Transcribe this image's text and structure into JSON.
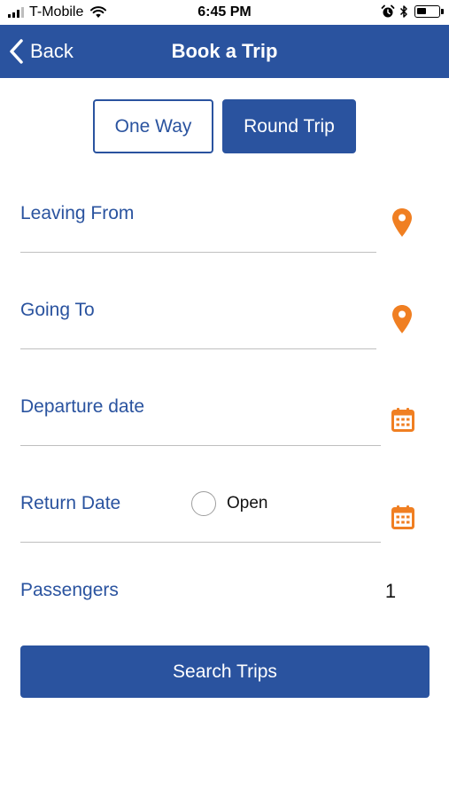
{
  "status_bar": {
    "carrier": "T-Mobile",
    "time": "6:45 PM",
    "battery_level": 0.45
  },
  "nav": {
    "back_label": "Back",
    "title": "Book a Trip"
  },
  "trip_type": {
    "options": [
      "One Way",
      "Round Trip"
    ],
    "selected": "Round Trip"
  },
  "form": {
    "leaving_from_label": "Leaving From",
    "going_to_label": "Going To",
    "departure_date_label": "Departure date",
    "return_date_label": "Return Date",
    "open_label": "Open",
    "open_checked": false,
    "passengers_label": "Passengers",
    "passengers_value": "1"
  },
  "search_button_label": "Search Trips",
  "colors": {
    "primary": "#2a539f",
    "accent": "#f07f22",
    "divider": "#bfbfbf"
  },
  "icons": [
    "back-chevron-icon",
    "map-pin-icon",
    "calendar-icon",
    "wifi-icon",
    "alarm-icon",
    "bluetooth-icon",
    "battery-icon",
    "signal-icon"
  ]
}
